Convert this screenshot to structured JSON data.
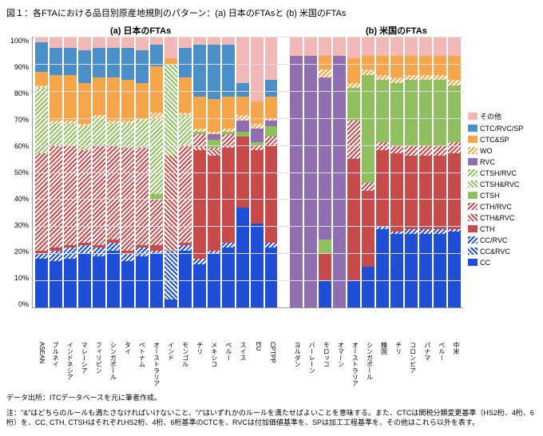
{
  "title": "図１：各FTAにおける品目別原産地規則のパターン：(a) 日本のFTAsと (b) 米国のFTAs",
  "subtitle_a": "(a) 日本のFTAs",
  "subtitle_b": "(b) 米国のFTAs",
  "source": "データ出所：ITCデータベースを元に筆者作成。",
  "note": "注：\"&\"はどちらのルールも満たさなければいけないこと、\"/\"はいずれかのルールを満たせばよいことを意味する。また、CTCは関税分類変更基準（HS2桁、4桁、6桁）を、CC, CTH, CTSHはそれぞれHS2桁、4桁、6桁基準のCTCを、RVCは付加価値基準を、SPは加工工程基準を、その他はこれら以外を表す。",
  "legend": [
    {
      "key": "Other",
      "label": "その他",
      "cls": "cOther"
    },
    {
      "key": "CTCRVCSP",
      "label": "CTC/RVC/SP",
      "cls": "cCTCRVCSP"
    },
    {
      "key": "CTCSP",
      "label": "CTC&SP",
      "cls": "cCTCSP"
    },
    {
      "key": "WO",
      "label": "WO",
      "cls": "cWO"
    },
    {
      "key": "RVC",
      "label": "RVC",
      "cls": "cRVC"
    },
    {
      "key": "CTSHoRVC",
      "label": "CTSH/RVC",
      "cls": "cCTSHoRVC"
    },
    {
      "key": "CTSHRVC",
      "label": "CTSH&RVC",
      "cls": "cCTSHRVC"
    },
    {
      "key": "CTSH",
      "label": "CTSH",
      "cls": "cCTSH"
    },
    {
      "key": "CTHoRVC",
      "label": "CTH/RVC",
      "cls": "cCTHoRVC"
    },
    {
      "key": "CTHRVC",
      "label": "CTH&RVC",
      "cls": "cCTHRVC"
    },
    {
      "key": "CTH",
      "label": "CTH",
      "cls": "cCTH"
    },
    {
      "key": "CCoRVC",
      "label": "CC/RVC",
      "cls": "cCCoRVC"
    },
    {
      "key": "CCRVC",
      "label": "CC&RVC",
      "cls": "cCCRVC"
    },
    {
      "key": "CC",
      "label": "CC",
      "cls": "cCC"
    }
  ],
  "y_ticks": [
    "100%",
    "90%",
    "80%",
    "70%",
    "60%",
    "50%",
    "40%",
    "30%",
    "20%",
    "10%",
    "0%"
  ],
  "chart_data": {
    "type": "bar",
    "stacked": true,
    "ylim": [
      0,
      100
    ],
    "ylabel": "%",
    "panels": [
      "(a) 日本のFTAs",
      "(b) 米国のFTAs"
    ],
    "categories_a": [
      "ASEAN",
      "ブルネイ",
      "インドネシア",
      "マレーシア",
      "フィリピン",
      "シンガポール",
      "タイ",
      "ベトナム",
      "オーストラリア",
      "インド",
      "モンゴル",
      "チリ",
      "メキシコ",
      "ペルー",
      "スイス",
      "EU",
      "CPTPP"
    ],
    "categories_b": [
      "ヨルダン",
      "バーレーン",
      "モロッコ",
      "オマーン",
      "オーストラリア",
      "シンガポール",
      "韓国",
      "チリ",
      "コロンビア",
      "パナマ",
      "ペルー",
      "中米"
    ],
    "series_keys_bottom_up": [
      "CC",
      "CCRVC",
      "CCoRVC",
      "CTH",
      "CTHRVC",
      "CTHoRVC",
      "CTSH",
      "CTSHRVC",
      "CTSHoRVC",
      "RVC",
      "WO",
      "CTCSP",
      "CTCRVCSP",
      "Other"
    ],
    "data_a": {
      "ASEAN": {
        "CC": 18,
        "CCoRVC": 2,
        "CTH": 1,
        "CTHoRVC": 36,
        "CTSHoRVC": 24,
        "WO": 1,
        "CTCSP": 5,
        "CTCRVCSP": 11,
        "Other": 2
      },
      "ブルネイ": {
        "CC": 17,
        "CCoRVC": 4,
        "CTH": 1,
        "CTHoRVC": 38,
        "CTSHoRVC": 8,
        "WO": 1,
        "CTCSP": 17,
        "CTCRVCSP": 10,
        "Other": 4
      },
      "インドネシア": {
        "CC": 18,
        "CCoRVC": 4,
        "CTH": 1,
        "CTHoRVC": 37,
        "CTSHoRVC": 8,
        "WO": 1,
        "CTCSP": 17,
        "CTCRVCSP": 10,
        "Other": 4
      },
      "マレーシア": {
        "CC": 20,
        "CCoRVC": 3,
        "CTH": 1,
        "CTHoRVC": 34,
        "CTSHoRVC": 9,
        "WO": 1,
        "CTCSP": 15,
        "CTCRVCSP": 12,
        "Other": 5
      },
      "フィリピン": {
        "CC": 19,
        "CCoRVC": 3,
        "CTH": 1,
        "CTHoRVC": 37,
        "CTSHoRVC": 10,
        "WO": 1,
        "CTCSP": 14,
        "CTCRVCSP": 11,
        "Other": 4
      },
      "シンガポール": {
        "CC": 21,
        "CCoRVC": 3,
        "CTH": 1,
        "CTHoRVC": 35,
        "CTSHoRVC": 8,
        "WO": 1,
        "CTCSP": 16,
        "CTCRVCSP": 11,
        "Other": 4
      },
      "タイ": {
        "CC": 17,
        "CCoRVC": 3,
        "CTH": 1,
        "CTHoRVC": 38,
        "CTSHoRVC": 9,
        "WO": 1,
        "CTCSP": 15,
        "CTCRVCSP": 12,
        "Other": 4
      },
      "ベトナム": {
        "CC": 19,
        "CCoRVC": 3,
        "CTH": 1,
        "CTHoRVC": 36,
        "CTSHoRVC": 10,
        "WO": 1,
        "CTCSP": 13,
        "CTCRVCSP": 12,
        "Other": 5
      },
      "オーストラリア": {
        "CC": 20,
        "CCoRVC": 1,
        "CTH": 2,
        "CTHoRVC": 17,
        "CTSH": 2,
        "CTSHoRVC": 28,
        "WO": 2,
        "CTCSP": 17,
        "CTCRVCSP": 8,
        "Other": 3
      },
      "インド": {
        "CC": 3,
        "CCRVC": 18,
        "CTHRVC": 35,
        "CTSHRVC": 34,
        "CTCSP": 2,
        "Other": 8
      },
      "モンゴル": {
        "CC": 21,
        "CCoRVC": 2,
        "CTH": 1,
        "CTHoRVC": 36,
        "CTSHoRVC": 11,
        "WO": 1,
        "CTCSP": 13,
        "CTCRVCSP": 11,
        "Other": 4
      },
      "チリ": {
        "CC": 16,
        "CCoRVC": 2,
        "CTH": 40,
        "CTHRVC": 1,
        "CTHoRVC": 5,
        "CTSH": 1,
        "WO": 1,
        "CTCSP": 12,
        "CTCRVCSP": 19,
        "Other": 3
      },
      "メキシコ": {
        "CC": 20,
        "CCoRVC": 1,
        "CTH": 35,
        "CTHRVC": 2,
        "CTHoRVC": 1,
        "CTSH": 3,
        "RVC": 2,
        "WO": 1,
        "CTCSP": 12,
        "CTCRVCSP": 20,
        "Other": 3
      },
      "ペルー": {
        "CC": 22,
        "CCoRVC": 2,
        "CTH": 35,
        "CTHoRVC": 5,
        "CTSH": 1,
        "WO": 1,
        "CTCSP": 12,
        "CTCRVCSP": 19,
        "Other": 3
      },
      "スイス": {
        "CC": 37,
        "CTH": 26,
        "CTSH": 2,
        "RVC": 4,
        "WO": 2,
        "CTCSP": 7,
        "CTCRVCSP": 5,
        "Other": 17
      },
      "EU": {
        "CC": 31,
        "CTH": 27,
        "CTHoRVC": 2,
        "CTSH": 1,
        "RVC": 5,
        "WO": 2,
        "CTCSP": 8,
        "Other": 24
      },
      "CPTPP": {
        "CC": 22,
        "CCoRVC": 2,
        "CTH": 36,
        "CTHoRVC": 3,
        "CTSH": 4,
        "RVC": 2,
        "WO": 1,
        "CTCSP": 8,
        "CTCRVCSP": 6,
        "Other": 16
      }
    },
    "data_b": {
      "ヨルダン": {
        "RVC": 93,
        "Other": 7
      },
      "バーレーン": {
        "RVC": 93,
        "Other": 7
      },
      "モロッコ": {
        "CC": 10,
        "CTH": 10,
        "CTSH": 5,
        "RVC": 60,
        "WO": 3,
        "CTCSP": 5,
        "Other": 7
      },
      "オマーン": {
        "RVC": 93,
        "Other": 7
      },
      "オーストラリア": {
        "CC": 10,
        "CTH": 45,
        "CTHoRVC": 14,
        "CTSH": 12,
        "WO": 2,
        "CTCSP": 9,
        "Other": 8
      },
      "シンガポール": {
        "CC": 15,
        "CTH": 28,
        "CTHoRVC": 3,
        "CTSH": 40,
        "WO": 2,
        "CTCSP": 5,
        "Other": 7
      },
      "韓国": {
        "CC": 29,
        "CCoRVC": 1,
        "CTH": 28,
        "CTHoRVC": 3,
        "CTSH": 23,
        "WO": 2,
        "CTCSP": 7,
        "Other": 7
      },
      "チリ": {
        "CC": 27,
        "CCoRVC": 1,
        "CTH": 29,
        "CTHoRVC": 3,
        "CTSH": 23,
        "WO": 2,
        "CTCSP": 8,
        "Other": 7
      },
      "コロンビア": {
        "CC": 27,
        "CCoRVC": 2,
        "CTH": 27,
        "CTHoRVC": 4,
        "CTSH": 24,
        "WO": 2,
        "CTCSP": 7,
        "Other": 7
      },
      "パナマ": {
        "CC": 27,
        "CCoRVC": 2,
        "CTH": 27,
        "CTHoRVC": 4,
        "CTSH": 24,
        "WO": 2,
        "CTCSP": 7,
        "Other": 7
      },
      "ペルー": {
        "CC": 27,
        "CCoRVC": 2,
        "CTH": 27,
        "CTHoRVC": 4,
        "CTSH": 24,
        "WO": 2,
        "CTCSP": 7,
        "Other": 7
      },
      "中米": {
        "CC": 28,
        "CCoRVC": 1,
        "CTH": 28,
        "CTHoRVC": 4,
        "CTSH": 21,
        "WO": 2,
        "CTCSP": 9,
        "Other": 7
      }
    }
  }
}
